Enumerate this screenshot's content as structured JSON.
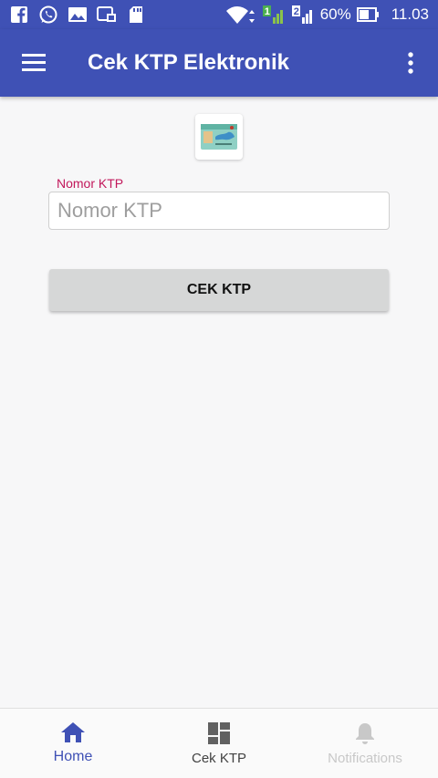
{
  "status_bar": {
    "battery": "60%",
    "time": "11.03",
    "sim1": "1",
    "sim2": "2"
  },
  "app_bar": {
    "title": "Cek KTP Elektronik"
  },
  "form": {
    "label": "Nomor KTP",
    "placeholder": "Nomor KTP",
    "value": "",
    "button_label": "CEK KTP"
  },
  "bottom_nav": {
    "items": [
      {
        "label": "Home",
        "icon": "home-icon",
        "state": "active"
      },
      {
        "label": "Cek KTP",
        "icon": "dashboard-icon",
        "state": "normal"
      },
      {
        "label": "Notifications",
        "icon": "bell-icon",
        "state": "disabled"
      }
    ]
  },
  "colors": {
    "primary": "#3f51b5",
    "label_accent": "#c2185b",
    "nav_active": "#3f51b5",
    "nav_normal": "#616161",
    "nav_disabled": "#c8c8c8"
  }
}
